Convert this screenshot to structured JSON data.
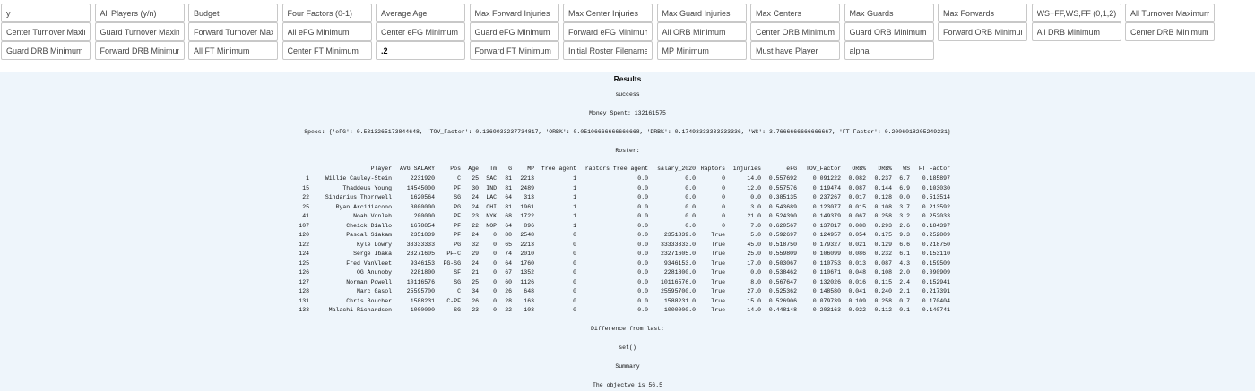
{
  "inputs": [
    {
      "placeholder": "y",
      "value": "",
      "row": 0,
      "col": 0
    },
    {
      "placeholder": "All Players (y/n)",
      "value": "",
      "row": 0,
      "col": 1
    },
    {
      "placeholder": "Budget",
      "value": "",
      "row": 0,
      "col": 2
    },
    {
      "placeholder": "Four Factors (0-1)",
      "value": "",
      "row": 0,
      "col": 3
    },
    {
      "placeholder": "Average Age",
      "value": "",
      "row": 0,
      "col": 4
    },
    {
      "placeholder": "Max Forward Injuries",
      "value": "",
      "row": 0,
      "col": 5
    },
    {
      "placeholder": "Max Center Injuries",
      "value": "",
      "row": 0,
      "col": 6
    },
    {
      "placeholder": "Max Guard Injuries",
      "value": "",
      "row": 0,
      "col": 7
    },
    {
      "placeholder": "Max Centers",
      "value": "",
      "row": 0,
      "col": 8
    },
    {
      "placeholder": "Max Guards",
      "value": "",
      "row": 0,
      "col": 9
    },
    {
      "placeholder": "Max Forwards",
      "value": "",
      "row": 0,
      "col": 10
    },
    {
      "placeholder": "WS+FF,WS,FF (0,1,2)",
      "value": "",
      "row": 0,
      "col": 11
    },
    {
      "placeholder": "All Turnover Maximum",
      "value": "",
      "row": 0,
      "col": 12
    },
    {
      "placeholder": "Center Turnover Maximum",
      "value": "",
      "row": 1,
      "col": 0
    },
    {
      "placeholder": "Guard Turnover Maximum",
      "value": "",
      "row": 1,
      "col": 1
    },
    {
      "placeholder": "Forward Turnover Max",
      "value": "",
      "row": 1,
      "col": 2
    },
    {
      "placeholder": "All eFG Minimum",
      "value": "",
      "row": 1,
      "col": 3
    },
    {
      "placeholder": "Center eFG Minimum",
      "value": "",
      "row": 1,
      "col": 4
    },
    {
      "placeholder": "Guard eFG Minimum",
      "value": "",
      "row": 1,
      "col": 5
    },
    {
      "placeholder": "Forward eFG Minimum",
      "value": "",
      "row": 1,
      "col": 6
    },
    {
      "placeholder": "All ORB Minimum",
      "value": "",
      "row": 1,
      "col": 7
    },
    {
      "placeholder": "Center ORB Minimum",
      "value": "",
      "row": 1,
      "col": 8
    },
    {
      "placeholder": "Guard ORB Minimum",
      "value": "",
      "row": 1,
      "col": 9
    },
    {
      "placeholder": "Forward ORB Minimum",
      "value": "",
      "row": 1,
      "col": 10
    },
    {
      "placeholder": "All DRB Minimum",
      "value": "",
      "row": 1,
      "col": 11
    },
    {
      "placeholder": "Center DRB Minimum",
      "value": "",
      "row": 1,
      "col": 12
    },
    {
      "placeholder": "Guard DRB Minimum",
      "value": "",
      "row": 2,
      "col": 0
    },
    {
      "placeholder": "Forward DRB Minimum",
      "value": "",
      "row": 2,
      "col": 1
    },
    {
      "placeholder": "All FT Minimum",
      "value": "",
      "row": 2,
      "col": 2
    },
    {
      "placeholder": "Center FT Minimum",
      "value": "",
      "row": 2,
      "col": 3
    },
    {
      "placeholder": "",
      "value": ".2",
      "row": 2,
      "col": 4
    },
    {
      "placeholder": "Forward FT Minimum",
      "value": "",
      "row": 2,
      "col": 5
    },
    {
      "placeholder": "Initial Roster Filename",
      "value": "",
      "row": 2,
      "col": 6
    },
    {
      "placeholder": "MP Minimum",
      "value": "",
      "row": 2,
      "col": 7
    },
    {
      "placeholder": "Must have Player",
      "value": "",
      "row": 2,
      "col": 8
    },
    {
      "placeholder": "alpha",
      "value": "",
      "row": 2,
      "col": 9
    }
  ],
  "results": {
    "title": "Results",
    "status": "success",
    "money_spent": "Money Spent: 132161575",
    "specs": "Specs: {'eFG': 0.5313265173844648, 'TOV_Factor': 0.1369033237734817, 'ORB%': 0.05106666666666668, 'DRB%': 0.17493333333333336, 'WS': 3.7666666666666667, 'FT Factor': 0.2006018205249231}",
    "roster_label": "Roster:",
    "columns": [
      "",
      "Player",
      "AVG SALARY",
      "Pos",
      "Age",
      "Tm",
      "G",
      "MP",
      "free agent",
      "raptors free agent",
      "salary_2020",
      "Raptors",
      "injuries",
      "eFG",
      "TOV_Factor",
      "ORB%",
      "DRB%",
      "WS",
      "FT Factor"
    ],
    "rows": [
      [
        "1",
        "Willie Cauley-Stein",
        "2231920",
        "C",
        "25",
        "SAC",
        "81",
        "2213",
        "1",
        "0.0",
        "0.0",
        "0",
        "14.0",
        "0.557692",
        "0.091222",
        "0.082",
        "0.237",
        "6.7",
        "0.185897"
      ],
      [
        "15",
        "Thaddeus Young",
        "14545000",
        "PF",
        "30",
        "IND",
        "81",
        "2489",
        "1",
        "0.0",
        "0.0",
        "0",
        "12.0",
        "0.557576",
        "0.119474",
        "0.087",
        "0.144",
        "6.9",
        "0.103030"
      ],
      [
        "22",
        "Sindarius Thornwell",
        "1620564",
        "SG",
        "24",
        "LAC",
        "64",
        "313",
        "1",
        "0.0",
        "0.0",
        "0",
        "0.0",
        "0.385135",
        "0.237267",
        "0.017",
        "0.128",
        "0.0",
        "0.513514"
      ],
      [
        "25",
        "Ryan Arcidiacono",
        "3000000",
        "PG",
        "24",
        "CHI",
        "81",
        "1961",
        "1",
        "0.0",
        "0.0",
        "0",
        "3.0",
        "0.543689",
        "0.123077",
        "0.015",
        "0.108",
        "3.7",
        "0.213592"
      ],
      [
        "41",
        "Noah Vonleh",
        "200000",
        "PF",
        "23",
        "NYK",
        "68",
        "1722",
        "1",
        "0.0",
        "0.0",
        "0",
        "21.0",
        "0.524390",
        "0.149379",
        "0.067",
        "0.258",
        "3.2",
        "0.252033"
      ],
      [
        "107",
        "Cheick Diallo",
        "1678854",
        "PF",
        "22",
        "NOP",
        "64",
        "896",
        "1",
        "0.0",
        "0.0",
        "0",
        "7.0",
        "0.620567",
        "0.137817",
        "0.088",
        "0.293",
        "2.6",
        "0.184397"
      ],
      [
        "120",
        "Pascal Siakam",
        "2351839",
        "PF",
        "24",
        "0",
        "80",
        "2548",
        "0",
        "0.0",
        "2351839.0",
        "True",
        "5.0",
        "0.592697",
        "0.124957",
        "0.054",
        "0.175",
        "9.3",
        "0.252809"
      ],
      [
        "122",
        "Kyle Lowry",
        "33333333",
        "PG",
        "32",
        "0",
        "65",
        "2213",
        "0",
        "0.0",
        "33333333.0",
        "True",
        "45.0",
        "0.518750",
        "0.179327",
        "0.021",
        "0.129",
        "6.6",
        "0.218750"
      ],
      [
        "124",
        "Serge Ibaka",
        "23271605",
        "PF-C",
        "29",
        "0",
        "74",
        "2010",
        "0",
        "0.0",
        "23271605.0",
        "True",
        "25.0",
        "0.559809",
        "0.106099",
        "0.086",
        "0.232",
        "6.1",
        "0.153110"
      ],
      [
        "125",
        "Fred VanVleet",
        "9346153",
        "PG-SG",
        "24",
        "0",
        "64",
        "1760",
        "0",
        "0.0",
        "9346153.0",
        "True",
        "17.0",
        "0.503067",
        "0.110753",
        "0.013",
        "0.087",
        "4.3",
        "0.159509"
      ],
      [
        "126",
        "OG Anunoby",
        "2281800",
        "SF",
        "21",
        "0",
        "67",
        "1352",
        "0",
        "0.0",
        "2281800.0",
        "True",
        "0.0",
        "0.538462",
        "0.110671",
        "0.048",
        "0.108",
        "2.0",
        "0.090909"
      ],
      [
        "127",
        "Norman Powell",
        "10116576",
        "SG",
        "25",
        "0",
        "60",
        "1126",
        "0",
        "0.0",
        "10116576.0",
        "True",
        "8.0",
        "0.567647",
        "0.132026",
        "0.016",
        "0.115",
        "2.4",
        "0.152941"
      ],
      [
        "128",
        "Marc Gasol",
        "25595700",
        "C",
        "34",
        "0",
        "26",
        "648",
        "0",
        "0.0",
        "25595700.0",
        "True",
        "27.0",
        "0.525362",
        "0.148580",
        "0.041",
        "0.240",
        "2.1",
        "0.217391"
      ],
      [
        "131",
        "Chris Boucher",
        "1588231",
        "C-PF",
        "26",
        "0",
        "28",
        "163",
        "0",
        "0.0",
        "1588231.0",
        "True",
        "15.0",
        "0.526906",
        "0.079739",
        "0.109",
        "0.258",
        "0.7",
        "0.170404"
      ],
      [
        "133",
        "Malachi Richardson",
        "1000000",
        "SG",
        "23",
        "0",
        "22",
        "103",
        "0",
        "0.0",
        "1000000.0",
        "True",
        "14.0",
        "0.448148",
        "0.203163",
        "0.022",
        "0.112",
        "-0.1",
        "0.140741"
      ]
    ],
    "difference_label": "Difference from last:",
    "difference_value": "set()",
    "summary_label": "Summary",
    "objective": "The objectve is 56.5"
  }
}
